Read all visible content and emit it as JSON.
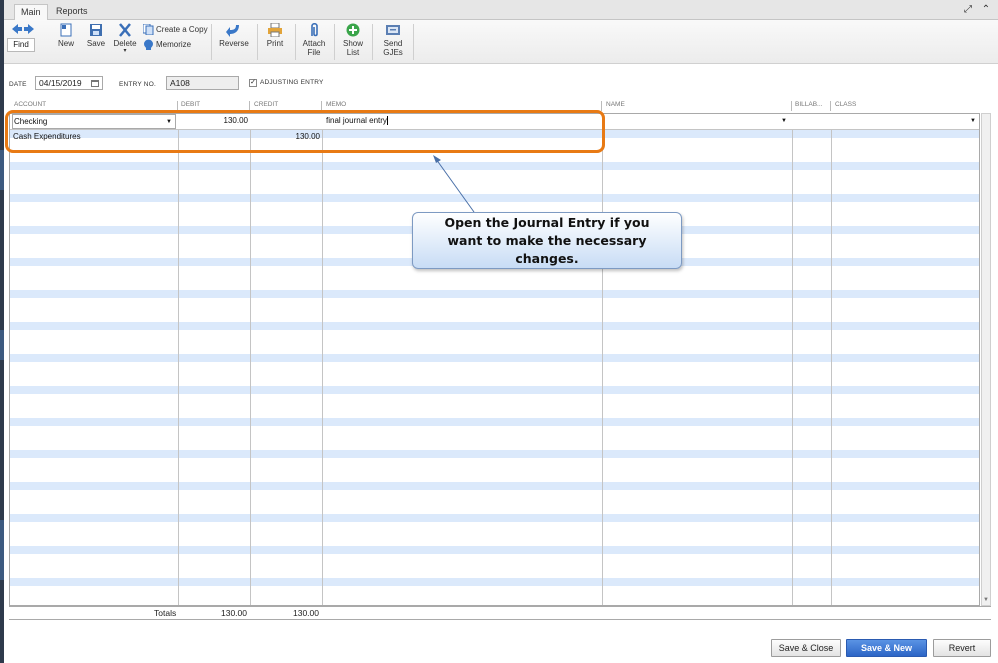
{
  "tabs": [
    {
      "label": "Main"
    },
    {
      "label": "Reports"
    }
  ],
  "toolbar": {
    "find_label": "Find",
    "new_label": "New",
    "save_label": "Save",
    "delete_label": "Delete",
    "create_copy_label": "Create a Copy",
    "memorize_label": "Memorize",
    "reverse_label": "Reverse",
    "print_label": "Print",
    "attach_label": "Attach\nFile",
    "attach_line1": "Attach",
    "attach_line2": "File",
    "show_list_line1": "Show",
    "show_list_line2": "List",
    "send_line1": "Send",
    "send_line2": "GJEs"
  },
  "header": {
    "date_label": "DATE",
    "date_value": "04/15/2019",
    "entry_no_label": "ENTRY NO.",
    "entry_no_value": "A108",
    "adjusting_label": "ADJUSTING ENTRY",
    "adjusting_checked": true
  },
  "grid": {
    "columns": [
      "ACCOUNT",
      "DEBIT",
      "CREDIT",
      "MEMO",
      "NAME",
      "BILLAB...",
      "CLASS"
    ],
    "rows": [
      {
        "account": "Checking",
        "debit": "130.00",
        "credit": "",
        "memo": "final journal entry"
      },
      {
        "account": "Cash Expenditures",
        "debit": "",
        "credit": "130.00",
        "memo": ""
      }
    ],
    "totals_label": "Totals",
    "totals_debit": "130.00",
    "totals_credit": "130.00"
  },
  "callout": {
    "text": "Open the Journal Entry if you want to make the necessary changes."
  },
  "buttons": {
    "save_close": "Save & Close",
    "save_new": "Save & New",
    "revert": "Revert"
  },
  "colors": {
    "highlight": "#e87a14",
    "row_stripe": "#dbe9fb",
    "primary_button": "#2c65c6"
  }
}
